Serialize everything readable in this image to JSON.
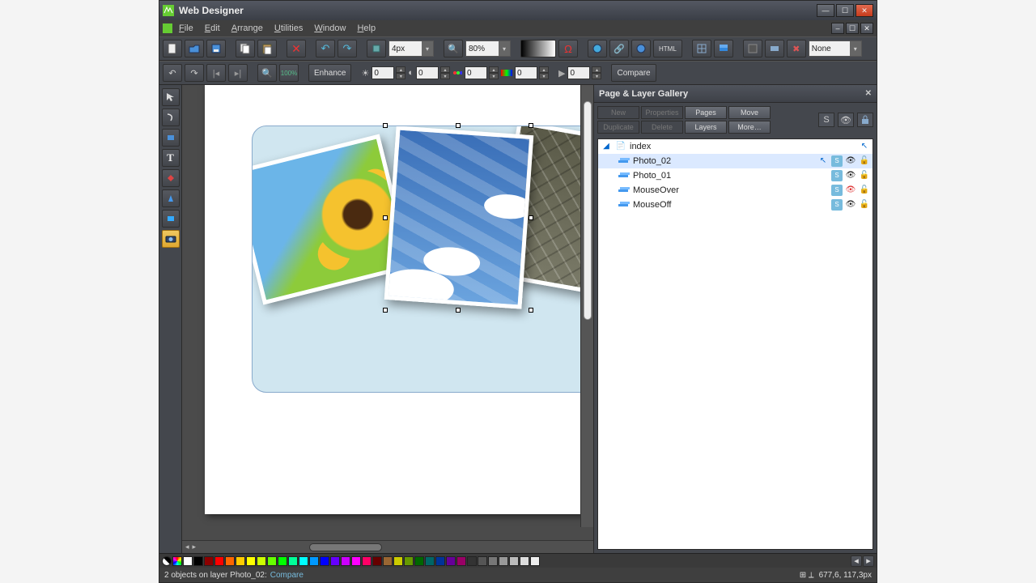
{
  "app": {
    "title": "Web Designer"
  },
  "menu": [
    "File",
    "Edit",
    "Arrange",
    "Utilities",
    "Window",
    "Help"
  ],
  "toolbar1": {
    "nudge": "4px",
    "zoom": "80%",
    "linkMode": "None"
  },
  "toolbar2": {
    "enhance": "Enhance",
    "brightness": "0",
    "contrast": "0",
    "saturation": "0",
    "hue": "0",
    "blur": "0",
    "compare": "Compare"
  },
  "gallery": {
    "title": "Page & Layer Gallery",
    "buttons": [
      "New",
      "Properties",
      "Pages",
      "Move",
      "Duplicate",
      "Delete",
      "Layers",
      "More…"
    ],
    "root": "index",
    "layers": [
      "Photo_02",
      "Photo_01",
      "MouseOver",
      "MouseOff"
    ]
  },
  "status": {
    "text": "2 objects on layer Photo_02:",
    "mode": "Compare",
    "coords": "677,6, 117,3px"
  },
  "swatches": [
    "#ffffff",
    "#000000",
    "#8b0000",
    "#ff0000",
    "#ff6600",
    "#ffcc00",
    "#ffff00",
    "#ccff00",
    "#66ff00",
    "#00ff00",
    "#00ff99",
    "#00ffff",
    "#0099ff",
    "#0000ff",
    "#6600ff",
    "#cc00ff",
    "#ff00ff",
    "#ff0066",
    "#660000",
    "#996633",
    "#cccc00",
    "#669900",
    "#006600",
    "#006666",
    "#003399",
    "#660099",
    "#990066",
    "#333333",
    "#555555",
    "#777777",
    "#999999",
    "#bbbbbb",
    "#dddddd",
    "#eeeeee"
  ]
}
